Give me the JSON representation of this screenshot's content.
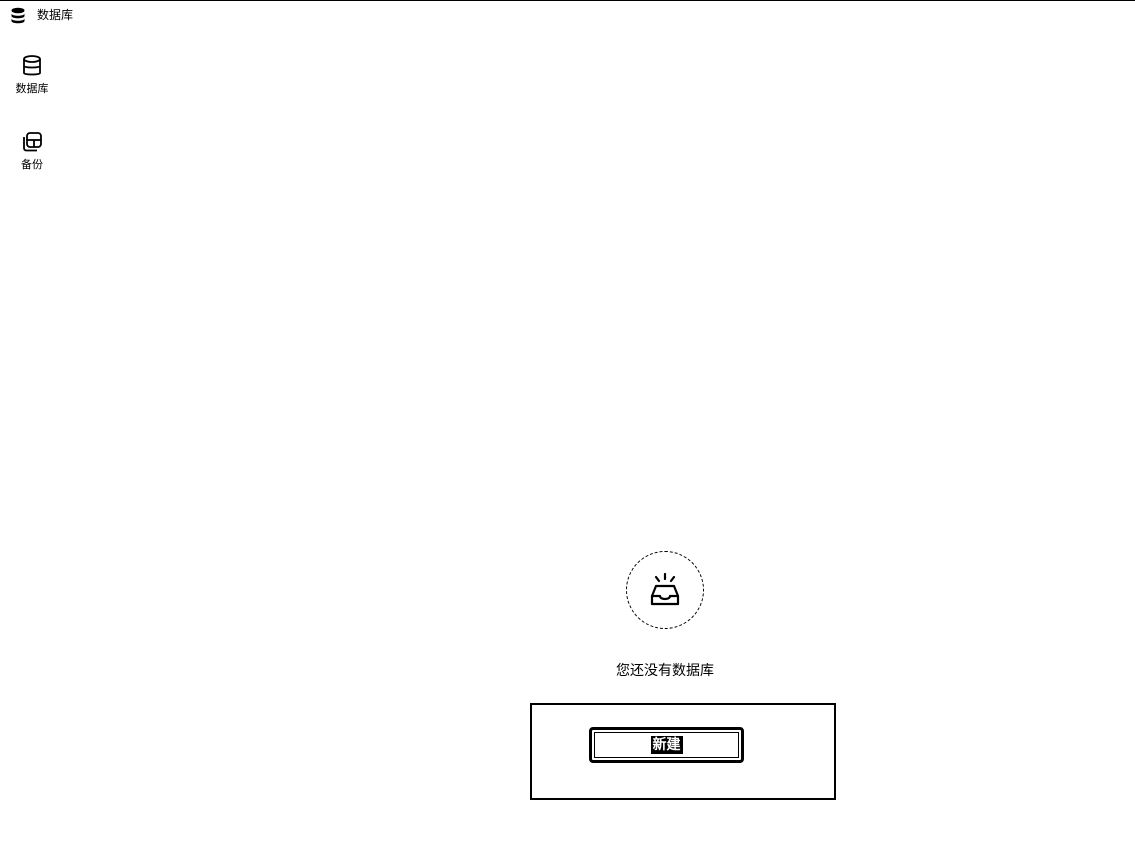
{
  "window": {
    "title": "数据库",
    "icon": "database-stack-icon"
  },
  "sidebar": {
    "items": [
      {
        "label": "数据库",
        "icon": "database-icon"
      },
      {
        "label": "备份",
        "icon": "backup-icon"
      }
    ]
  },
  "main": {
    "empty_state": {
      "icon": "empty-inbox-icon",
      "message": "您还没有数据库",
      "new_button_label": "新建"
    }
  }
}
